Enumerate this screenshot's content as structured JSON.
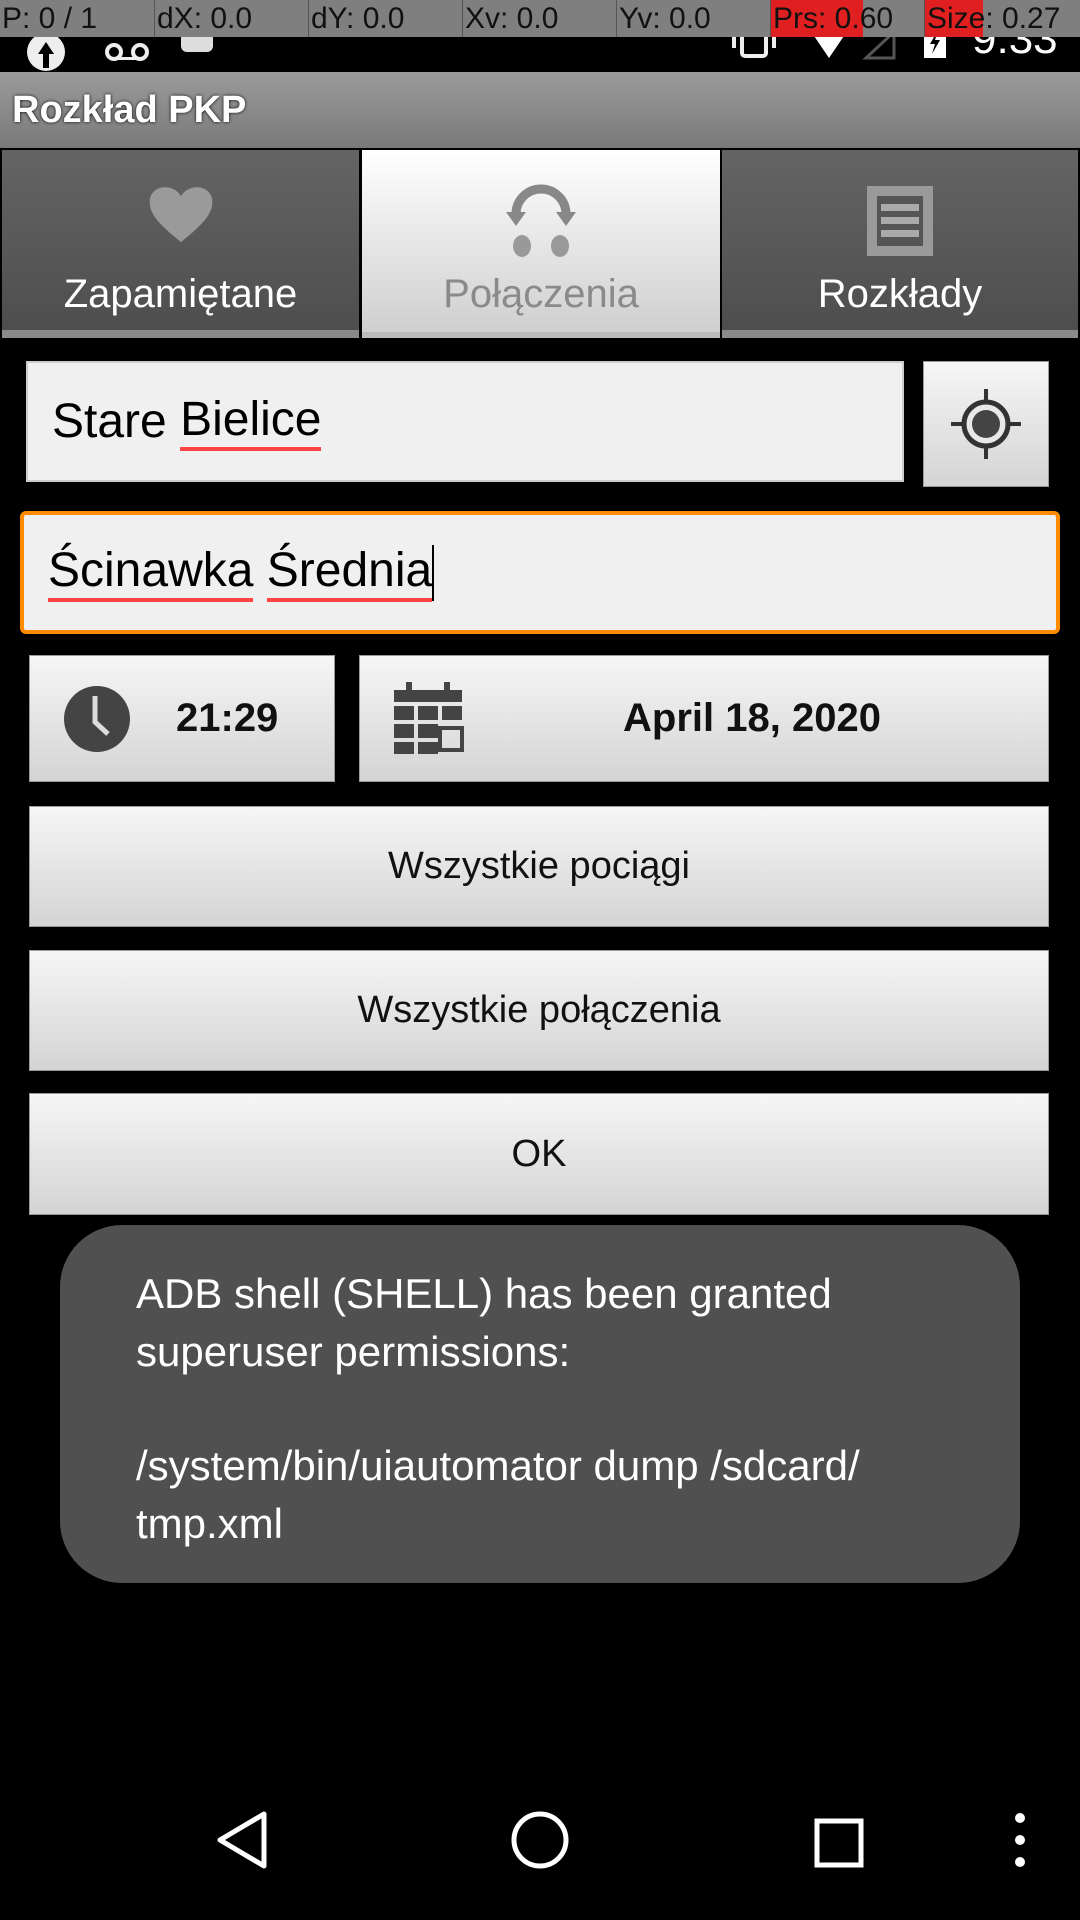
{
  "debug_overlay": [
    "P: 0 / 1",
    "dX: 0.0",
    "dY: 0.0",
    "Xv: 0.0",
    "Yv: 0.0",
    "Prs: 0.60",
    "Size: 0.27"
  ],
  "status_bar": {
    "time": "9:33"
  },
  "app_title": "Rozkład PKP",
  "tabs": [
    {
      "label": "Zapamiętane",
      "icon": "heart-icon"
    },
    {
      "label": "Połączenia",
      "icon": "connections-icon",
      "active": true
    },
    {
      "label": "Rozkłady",
      "icon": "timetable-icon"
    }
  ],
  "from_station": {
    "word1": "Stare ",
    "word2": "Bielice"
  },
  "to_station": {
    "word1": "Ścinawka",
    "space": " ",
    "word2": "Średnia"
  },
  "time": "21:29",
  "date": "April 18, 2020",
  "buttons": {
    "all_trains": "Wszystkie pociągi",
    "all_connections": "Wszystkie połączenia",
    "ok": "OK"
  },
  "toast": {
    "line1": "ADB shell (SHELL) has been granted",
    "line2": "superuser permissions:",
    "line3": "/system/bin/uiautomator dump /sdcard/",
    "line4": "tmp.xml"
  },
  "colors": {
    "focus": "#ff8c00",
    "spell": "#ff4444"
  }
}
